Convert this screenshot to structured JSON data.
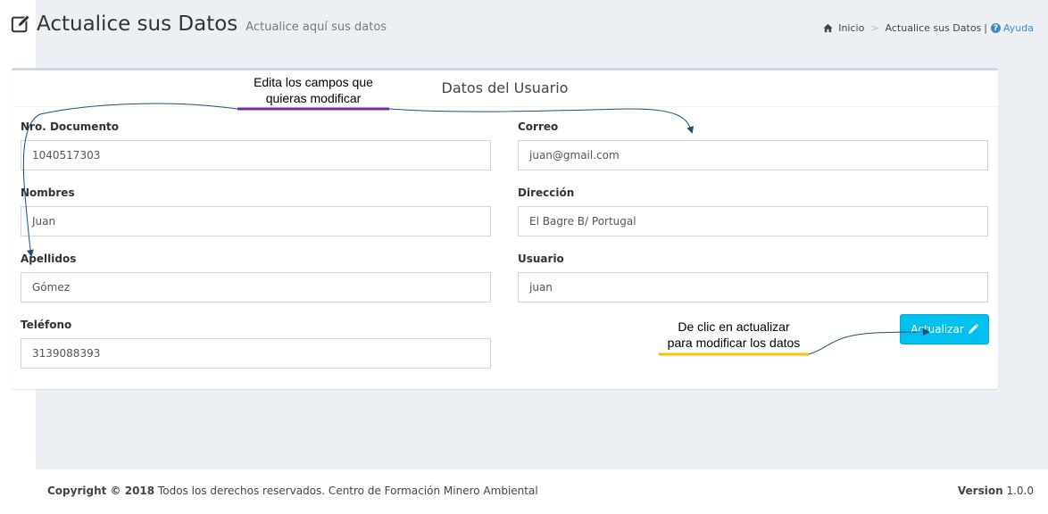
{
  "header": {
    "title": "Actualice sus Datos",
    "subtitle": "Actualice aquí sus datos",
    "icon": "edit-icon"
  },
  "breadcrumb": {
    "home": "Inicio",
    "current": "Actualice sus Datos",
    "separator": "|",
    "help": "Ayuda"
  },
  "form": {
    "title": "Datos del Usuario",
    "fields": {
      "documento": {
        "label": "Nro. Documento",
        "value": "1040517303"
      },
      "correo": {
        "label": "Correo",
        "value": "juan@gmail.com"
      },
      "nombres": {
        "label": "Nombres",
        "value": "Juan"
      },
      "direccion": {
        "label": "Dirección",
        "value": "El Bagre B/ Portugal"
      },
      "apellidos": {
        "label": "Apellidos",
        "value": "Gómez"
      },
      "usuario": {
        "label": "Usuario",
        "value": "juan"
      },
      "telefono": {
        "label": "Teléfono",
        "value": "3139088393"
      }
    },
    "submit_label": "Actualizar"
  },
  "annotations": {
    "edit_hint_line1": "Edita los campos que",
    "edit_hint_line2": "quieras modificar",
    "update_hint_line1": "De clic en actualizar",
    "update_hint_line2": "para modificar los datos"
  },
  "footer": {
    "copyright_bold": "Copyright © 2018",
    "copyright_text": "Todos los derechos reservados. Centro de Formación Minero Ambiental",
    "version_label": "Version",
    "version_value": "1.0.0"
  },
  "colors": {
    "background": "#ecf0f5",
    "accent": "#00c0ef",
    "link": "#3c8dbc",
    "annotation_purple": "#7030a0",
    "annotation_yellow": "#ffc000",
    "arrow": "#1f4e79"
  }
}
